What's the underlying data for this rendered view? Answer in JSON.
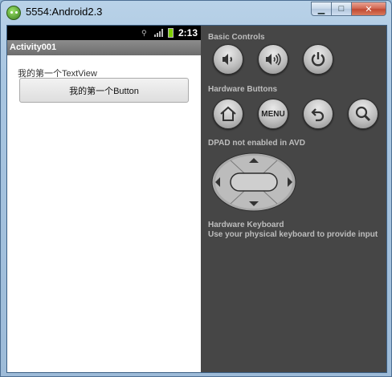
{
  "window": {
    "title": "5554:Android2.3",
    "controls": {
      "minimize": "▁",
      "maximize": "□",
      "close": "✕"
    }
  },
  "device": {
    "status_time": "2:13",
    "app_title": "Activity001",
    "textview_text": "我的第一个TextView",
    "button_label": "我的第一个Button"
  },
  "panel": {
    "basic_controls_label": "Basic Controls",
    "hardware_buttons_label": "Hardware Buttons",
    "menu_label": "MENU",
    "dpad_label": "DPAD not enabled in AVD",
    "keyboard_title": "Hardware Keyboard",
    "keyboard_desc": "Use your physical keyboard to provide input",
    "icons": {
      "basic": [
        "volume-down-icon",
        "volume-up-icon",
        "power-icon"
      ],
      "hardware": [
        "home-icon",
        "menu-icon",
        "back-icon",
        "search-icon"
      ]
    }
  },
  "colors": {
    "panel_bg": "#464646",
    "battery": "#7fd000",
    "title_blue": "#a9c6e1"
  }
}
